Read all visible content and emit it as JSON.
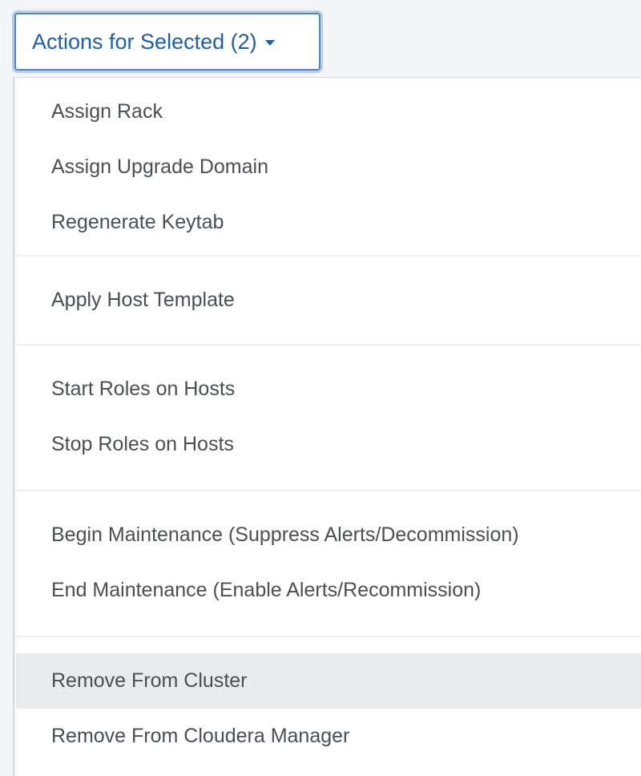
{
  "actions_button": {
    "label": "Actions for Selected (2)",
    "caret_icon": "caret-down-icon"
  },
  "menu": {
    "groups": [
      {
        "items": [
          {
            "label": "Assign Rack"
          },
          {
            "label": "Assign Upgrade Domain"
          },
          {
            "label": "Regenerate Keytab"
          }
        ]
      },
      {
        "items": [
          {
            "label": "Apply Host Template"
          }
        ]
      },
      {
        "items": [
          {
            "label": "Start Roles on Hosts"
          },
          {
            "label": "Stop Roles on Hosts"
          }
        ]
      },
      {
        "items": [
          {
            "label": "Begin Maintenance (Suppress Alerts/Decommission)"
          },
          {
            "label": "End Maintenance (Enable Alerts/Recommission)"
          }
        ]
      },
      {
        "items": [
          {
            "label": "Remove From Cluster",
            "highlighted": true
          },
          {
            "label": "Remove From Cloudera Manager"
          }
        ]
      }
    ]
  },
  "colors": {
    "accent": "#1e5fa8",
    "focus_border": "#4a86c8",
    "menu_text": "#4a4f55",
    "highlight_bg": "#e9ebed"
  }
}
